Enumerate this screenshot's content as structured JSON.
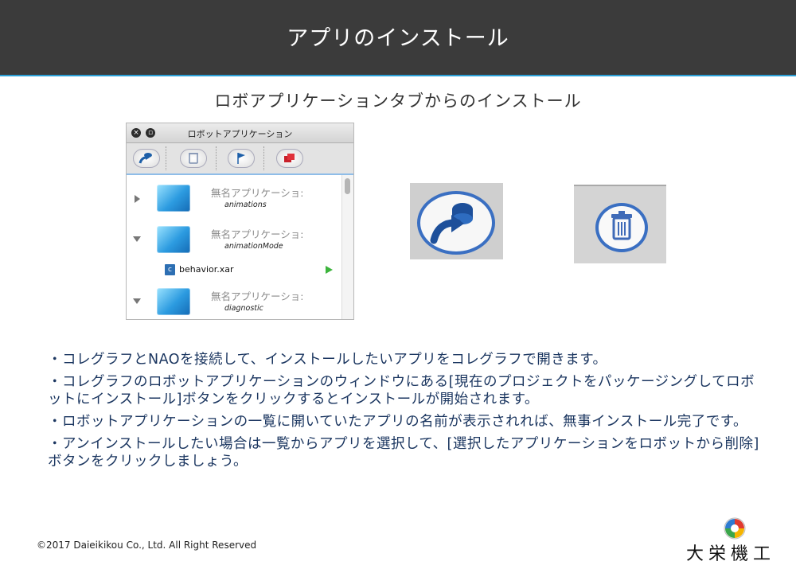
{
  "header": {
    "title": "アプリのインストール"
  },
  "subtitle": "ロボアプリケーションタブからのインストール",
  "window": {
    "title": "ロボットアプリケーション",
    "toolbar_icons": [
      "install-icon",
      "trash-icon",
      "flag-icon",
      "delete-apps-icon"
    ],
    "items": [
      {
        "name": "無名アプリケーショ:",
        "sub": "animations",
        "expanded": false
      },
      {
        "name": "無名アプリケーショ:",
        "sub": "animationMode",
        "expanded": true,
        "file": {
          "badge": "c",
          "name": "behavior.xar"
        }
      },
      {
        "name": "無名アプリケーショ:",
        "sub": "diagnostic",
        "expanded": false
      }
    ]
  },
  "bullets": [
    "・コレグラフとNAOを接続して、インストールしたいアプリをコレグラフで開きます。",
    "・コレグラフのロボットアプリケーションのウィンドウにある[現在のプロジェクトをパッケージングしてロボットにインストール]ボタンをクリックするとインストールが開始されます。",
    "・ロボットアプリケーションの一覧に開いていたアプリの名前が表示されれば、無事インストール完了です。",
    "・アンインストールしたい場合は一覧からアプリを選択して、[選択したアプリケーションをロボットから削除]ボタンをクリックしましょう。"
  ],
  "footer": {
    "copyright": "©2017 Daieikikou Co., Ltd. All Right Reserved",
    "company": "大栄機工"
  },
  "colors": {
    "header_bg": "#3b3b3b",
    "header_border": "#2a9fd6",
    "bullet_text": "#1b3660"
  }
}
